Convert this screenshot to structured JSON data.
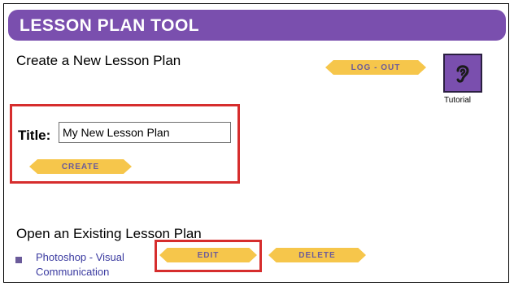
{
  "header": {
    "title": "LESSON PLAN TOOL"
  },
  "create_section": {
    "heading": "Create a New Lesson Plan",
    "title_label": "Title:",
    "title_value": "My New Lesson Plan",
    "create_label": "CREATE"
  },
  "top_actions": {
    "logout_label": "LOG - OUT",
    "tutorial_label": "Tutorial",
    "tutorial_icon": "ear-icon"
  },
  "open_section": {
    "heading": "Open an Existing Lesson Plan",
    "lessons": [
      {
        "name": "Photoshop - Visual Communication"
      }
    ],
    "edit_label": "EDIT",
    "delete_label": "DELETE"
  },
  "colors": {
    "header_purple": "#7a4fae",
    "button_gold": "#f6c64b",
    "highlight_red": "#d62d2d"
  }
}
